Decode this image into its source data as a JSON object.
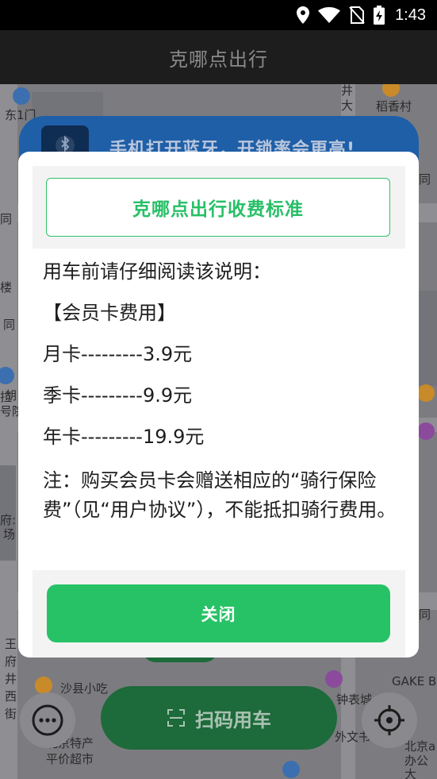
{
  "status_bar": {
    "time": "1:43",
    "icons": [
      "location-icon",
      "wifi-icon",
      "no-sim-icon",
      "battery-charging-icon"
    ]
  },
  "app_bar": {
    "title": "克哪点出行"
  },
  "map": {
    "labels": {
      "east_gate": "东1门",
      "jing": "井",
      "da": "大",
      "daoxiang_village": "稻香村",
      "tong1": "同",
      "tong2": "同",
      "lou": "楼",
      "tong3": "同",
      "hu": "胡",
      "hao_yuan": "号院",
      "la": "拉",
      "fu": "府:",
      "chang": "场",
      "wang": "王",
      "fu2": "府",
      "jing2": "井",
      "xi": "西",
      "jie": "街",
      "shaxian_snack": "沙县小吃",
      "clock_watch": "钟表城",
      "gake": "GAKE B",
      "foreign_lit": "外文书",
      "beijing_apt": "北京a",
      "office": "办公大",
      "pingjia_market": "平价超市",
      "beijing_special": "北京特产",
      "tong4": "同"
    },
    "bluetooth_banner_text": "手机打开蓝牙，开锁率会更高!",
    "scan_button_label": "扫码用车"
  },
  "dialog": {
    "title": "克哪点出行收费标准",
    "intro": "用车前请仔细阅读该说明：",
    "section": "【会员卡费用】",
    "prices": [
      {
        "text": "月卡---------3.9元"
      },
      {
        "text": "季卡---------9.9元"
      },
      {
        "text": "年卡---------19.9元"
      }
    ],
    "note": "注：购买会员卡会赠送相应的“骑行保险费”（见“用户协议”），不能抵扣骑行费用。",
    "close_label": "关闭"
  },
  "colors": {
    "accent_green": "#27c266",
    "title_green": "#27bf66",
    "app_bar_bg": "#1d1d1d"
  }
}
